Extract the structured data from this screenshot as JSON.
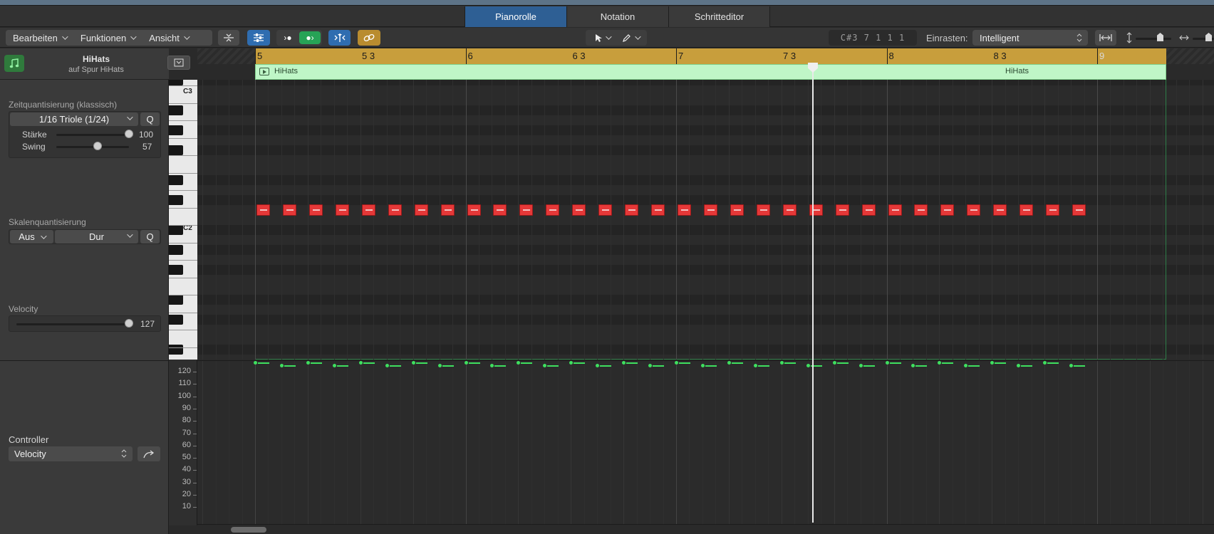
{
  "tabs": [
    {
      "label": "Pianorolle",
      "active": true
    },
    {
      "label": "Notation",
      "active": false
    },
    {
      "label": "Schritteditor",
      "active": false
    }
  ],
  "menus": {
    "edit": "Bearbeiten",
    "functions": "Funktionen",
    "view": "Ansicht"
  },
  "lcd": "C#3  7 1 1 1",
  "snap": {
    "label": "Einrasten:",
    "value": "Intelligent"
  },
  "region": {
    "title": "HiHats",
    "subtitle": "auf Spur HiHats"
  },
  "time_quant": {
    "section": "Zeitquantisierung (klassisch)",
    "value": "1/16 Triole (1/24)",
    "q": "Q",
    "strength_label": "Stärke",
    "strength_value": "100",
    "strength_level": 1.0,
    "swing_label": "Swing",
    "swing_value": "57",
    "swing_level": 0.57
  },
  "scale_quant": {
    "section": "Skalenquantisierung",
    "off": "Aus",
    "scale": "Dur",
    "q": "Q"
  },
  "velocity": {
    "section": "Velocity",
    "value": "127",
    "level": 1.0
  },
  "controller": {
    "section": "Controller",
    "value": "Velocity"
  },
  "ruler": [
    "5",
    "5 3",
    "6",
    "6 3",
    "7",
    "7 3",
    "8",
    "8 3",
    "9"
  ],
  "region_labels": [
    "HiHats",
    "HiHats"
  ],
  "keys": {
    "c3": "C3",
    "c2": "C2"
  },
  "velocity_scale": [
    "120",
    "110",
    "100",
    "90",
    "80",
    "70",
    "60",
    "50",
    "40",
    "30",
    "20",
    "10"
  ],
  "notes": {
    "count": 32,
    "pitch": "C2"
  },
  "colors": {
    "accent_tab": "#2e5f94",
    "note": "#e53838",
    "region": "#bff6c7",
    "ruler": "#c89e3c",
    "velocity": "#3ee05f"
  }
}
